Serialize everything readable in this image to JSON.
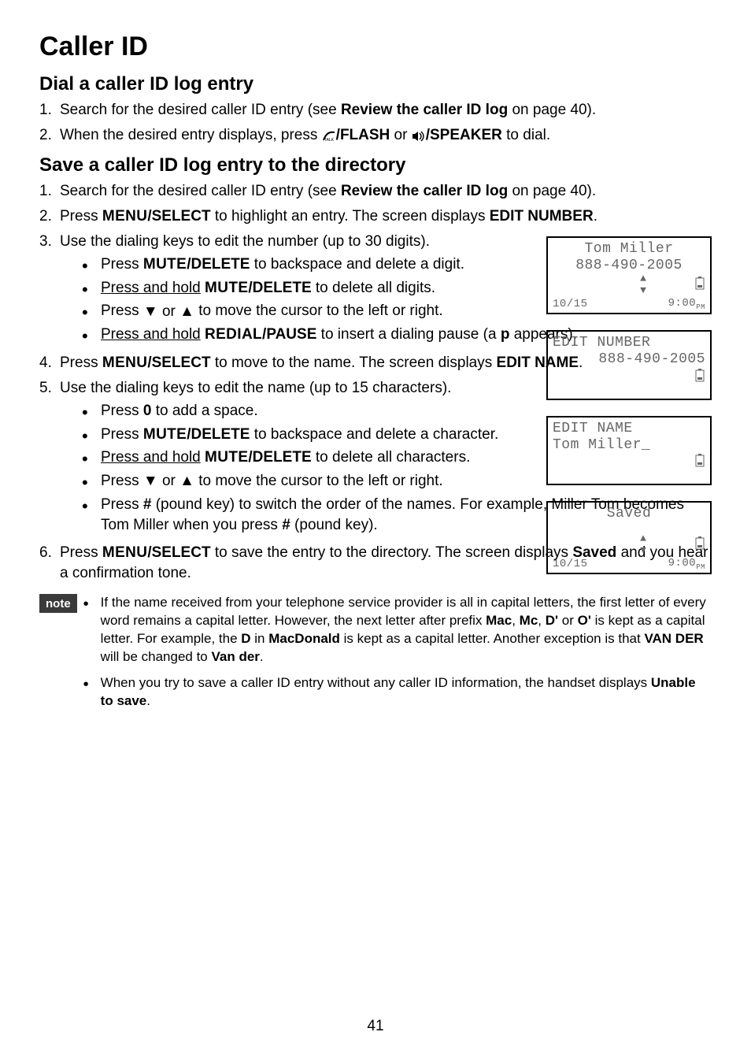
{
  "title": "Caller ID",
  "section_dial": {
    "heading": "Dial a caller ID log entry",
    "items": [
      {
        "pre": "Search for the desired caller ID entry (see ",
        "bold1": "Review the caller ID log",
        "post": " on page 40)."
      },
      {
        "pre": "When the desired entry displays, press ",
        "sc1": "/FLASH",
        "mid": " or ",
        "b2": "/SPEAKER",
        "post": " to dial."
      }
    ]
  },
  "section_save": {
    "heading": "Save a caller ID log entry to the directory",
    "li1": {
      "pre": "Search for the desired caller ID entry (see ",
      "bold1": "Review the caller ID log",
      "post": " on page 40)."
    },
    "li2": {
      "pre1": "Press ",
      "sc1": "MENU",
      "b1": "/SELECT",
      "mid": " to highlight an entry. The screen displays ",
      "b2": "EDIT NUMBER",
      "post": "."
    },
    "li3": {
      "text": "Use the dialing keys to edit the number (up to 30 digits)."
    },
    "li3_sub": [
      {
        "pre": "Press ",
        "sc": "MUTE",
        "b": "/DELETE",
        "post": " to backspace and delete a digit."
      },
      {
        "upre": "Press and hold",
        "sp": " ",
        "sc": "MUTE",
        "b": "/DELETE",
        "post": " to delete all digits."
      },
      {
        "pre": "Press ",
        "arr": "▼ or ▲",
        "post": " to move the cursor to the left or right."
      },
      {
        "upre": "Press and hold",
        "sp": " ",
        "sc": "REDIAL",
        "b": "/PAUSE",
        "post1": " to insert a dialing pause (a ",
        "b2": "p",
        "post2": " appears)."
      }
    ],
    "li4": {
      "pre1": "Press ",
      "sc1": "MENU",
      "b1": "/SELECT",
      "mid": " to move to the name. The screen displays ",
      "b2": "EDIT NAME",
      "post": "."
    },
    "li5": {
      "text": "Use the dialing keys to edit the name (up to 15 characters)."
    },
    "li5_sub": [
      {
        "pre": "Press ",
        "b": "0",
        "post": " to add a space."
      },
      {
        "pre": "Press ",
        "sc": "MUTE",
        "b2": "/DELETE",
        "post": " to backspace and delete a character."
      },
      {
        "upre": "Press and hold",
        "sp": " ",
        "sc": "MUTE",
        "b": "/DELETE",
        "post": " to delete all characters."
      },
      {
        "pre": "Press ",
        "arr": "▼ or ▲",
        "post": " to move the cursor to the left or right."
      },
      {
        "pre": "Press ",
        "b": "#",
        "post1": " (pound key) to switch the order of the names. For example, Miller Tom becomes Tom Miller when you press ",
        "b2": "#",
        "post2": " (pound key)."
      }
    ],
    "li6": {
      "pre1": "Press ",
      "sc1": "MENU",
      "b1": "/SELECT",
      "mid": " to save the entry to the directory. The screen displays ",
      "b2": "Saved",
      "post": " and you hear a confirmation tone."
    }
  },
  "note": {
    "label": "note",
    "items": [
      {
        "t1": "If the name received from your telephone service provider is all in capital letters, the first letter of every word remains a capital letter. However, the next letter after prefix ",
        "b1": "Mac",
        "c1": ", ",
        "b2": "Mc",
        "c2": ", ",
        "b3": "D'",
        "c3": " or ",
        "b4": "O'",
        "t2": " is kept as a capital letter. For example, the ",
        "b5": "D",
        "t3": " in ",
        "b6": "MacDonald",
        "t4": " is kept as a capital letter. Another exception is that ",
        "b7": "VAN DER",
        "t5": " will be changed to ",
        "b8": "Van der",
        "t6": "."
      },
      {
        "t1": "When you try to save a caller ID entry without any caller ID information, the handset displays ",
        "b1": "Unable to save",
        "t2": "."
      }
    ]
  },
  "lcd": {
    "p1": {
      "line1": "Tom Miller",
      "line2": "888-490-2005",
      "date": "10/15",
      "time": "9:00",
      "timesuf": "PM"
    },
    "p2": {
      "line1": "EDIT NUMBER",
      "line2": "888-490-2005"
    },
    "p3": {
      "line1": "EDIT NAME",
      "line2": "Tom Miller_"
    },
    "p4": {
      "line1": "Saved",
      "date": "10/15",
      "time": "9:00",
      "timesuf": "PM"
    }
  },
  "page_number": "41"
}
